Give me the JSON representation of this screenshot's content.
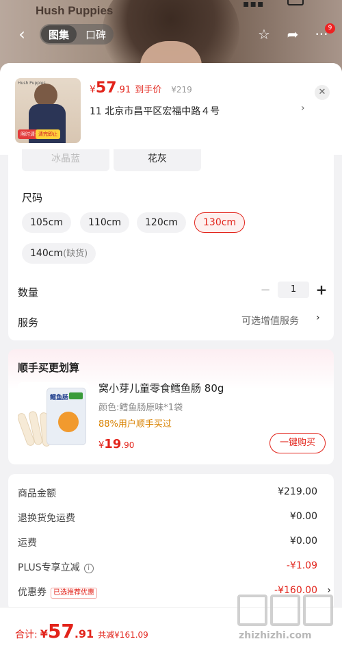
{
  "top_bar": {
    "brand": "Hush Puppies",
    "tab_gallery": "图集",
    "tab_reviews": "口碑",
    "cart_badge": "9",
    "icons": [
      "back-icon",
      "star-icon",
      "share-icon",
      "more-icon"
    ]
  },
  "product": {
    "price_currency": "¥",
    "price_int": "57",
    "price_dec": ".91",
    "price_label": "到手价",
    "original_price": "¥219",
    "address": "11  北京市昌平区宏福中路４号",
    "thumb_brand": "Hush Puppies",
    "thumb_tag1": "限时清仓",
    "thumb_tag2": "清完即止"
  },
  "spec": {
    "colors": [
      "冰晶蓝",
      "花灰"
    ],
    "size_title": "尺码",
    "sizes": [
      "105cm",
      "110cm",
      "120cm",
      "130cm",
      "140cm"
    ],
    "selected_size": "130cm",
    "out_of_stock_suffix": "(缺货)",
    "qty_title": "数量",
    "qty_value": "1",
    "service_title": "服务",
    "service_value": "可选增值服务"
  },
  "addon": {
    "title": "顺手买更划算",
    "name": "窝小芽儿童零食鳕鱼肠 80g",
    "color": "颜色:鳕鱼肠原味*1袋",
    "ratio": "88%用户顺手买过",
    "price_currency": "¥",
    "price_int": "19",
    "price_dec": ".90",
    "buy_label": "一键购买",
    "pkg_name": "鳕鱼肠"
  },
  "summary": {
    "rows": [
      {
        "label": "商品金额",
        "value": "¥219.00"
      },
      {
        "label": "退换货免运费",
        "value": "¥0.00"
      },
      {
        "label": "运费",
        "value": "¥0.00"
      },
      {
        "label": "PLUS专享立减",
        "value": "-¥1.09"
      },
      {
        "label": "优惠券",
        "value": "-¥160.00",
        "tag": "已选推荐优惠"
      }
    ]
  },
  "footer": {
    "total_label": "合计:",
    "total_currency": "¥",
    "total_int": "57",
    "total_dec": ".91",
    "total_save": "共减¥161.09",
    "watermark": "zhizhizhi.com"
  },
  "colors": {
    "accent": "#e2231a",
    "bg": "#f2f2f4"
  }
}
